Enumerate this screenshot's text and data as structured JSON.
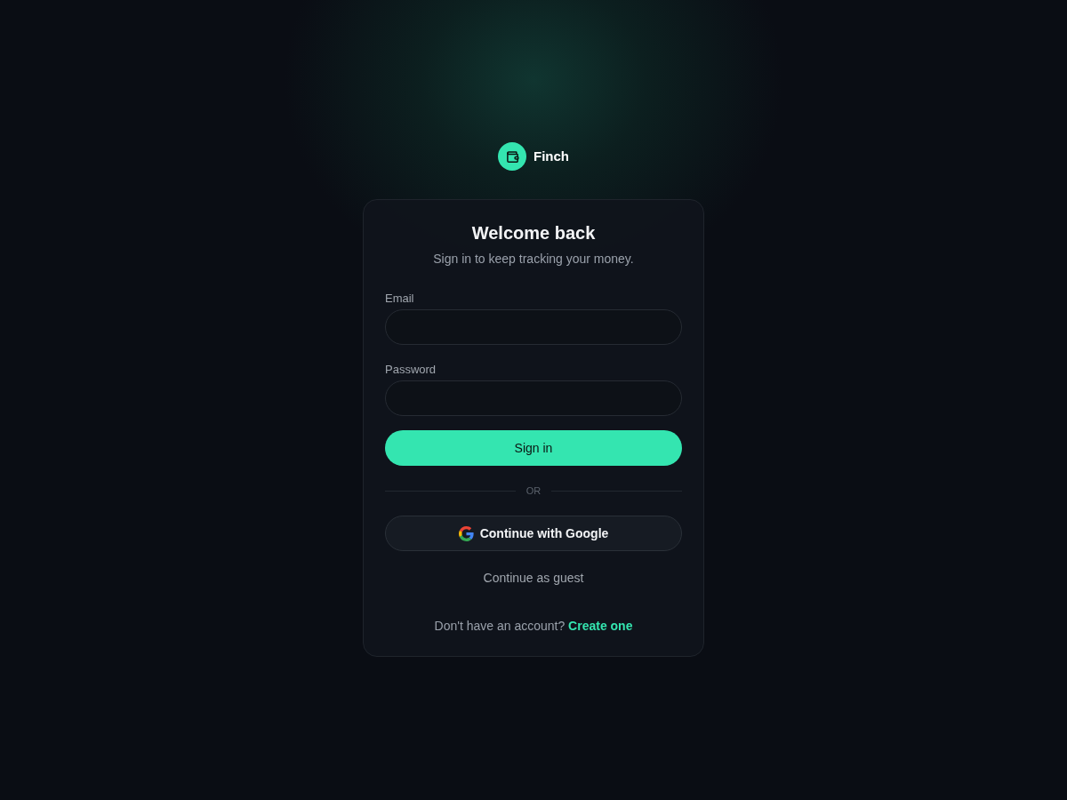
{
  "brand": {
    "name": "Finch"
  },
  "card": {
    "title": "Welcome back",
    "subtitle": "Sign in to keep tracking your money."
  },
  "fields": [
    {
      "label": "Email"
    },
    {
      "label": "Password"
    }
  ],
  "primary_button": "Sign in",
  "divider": "OR",
  "google_button": "Continue with Google",
  "guest_link": "Continue as guest",
  "footer": {
    "text": "Don't have an account?",
    "link": "Create one"
  }
}
